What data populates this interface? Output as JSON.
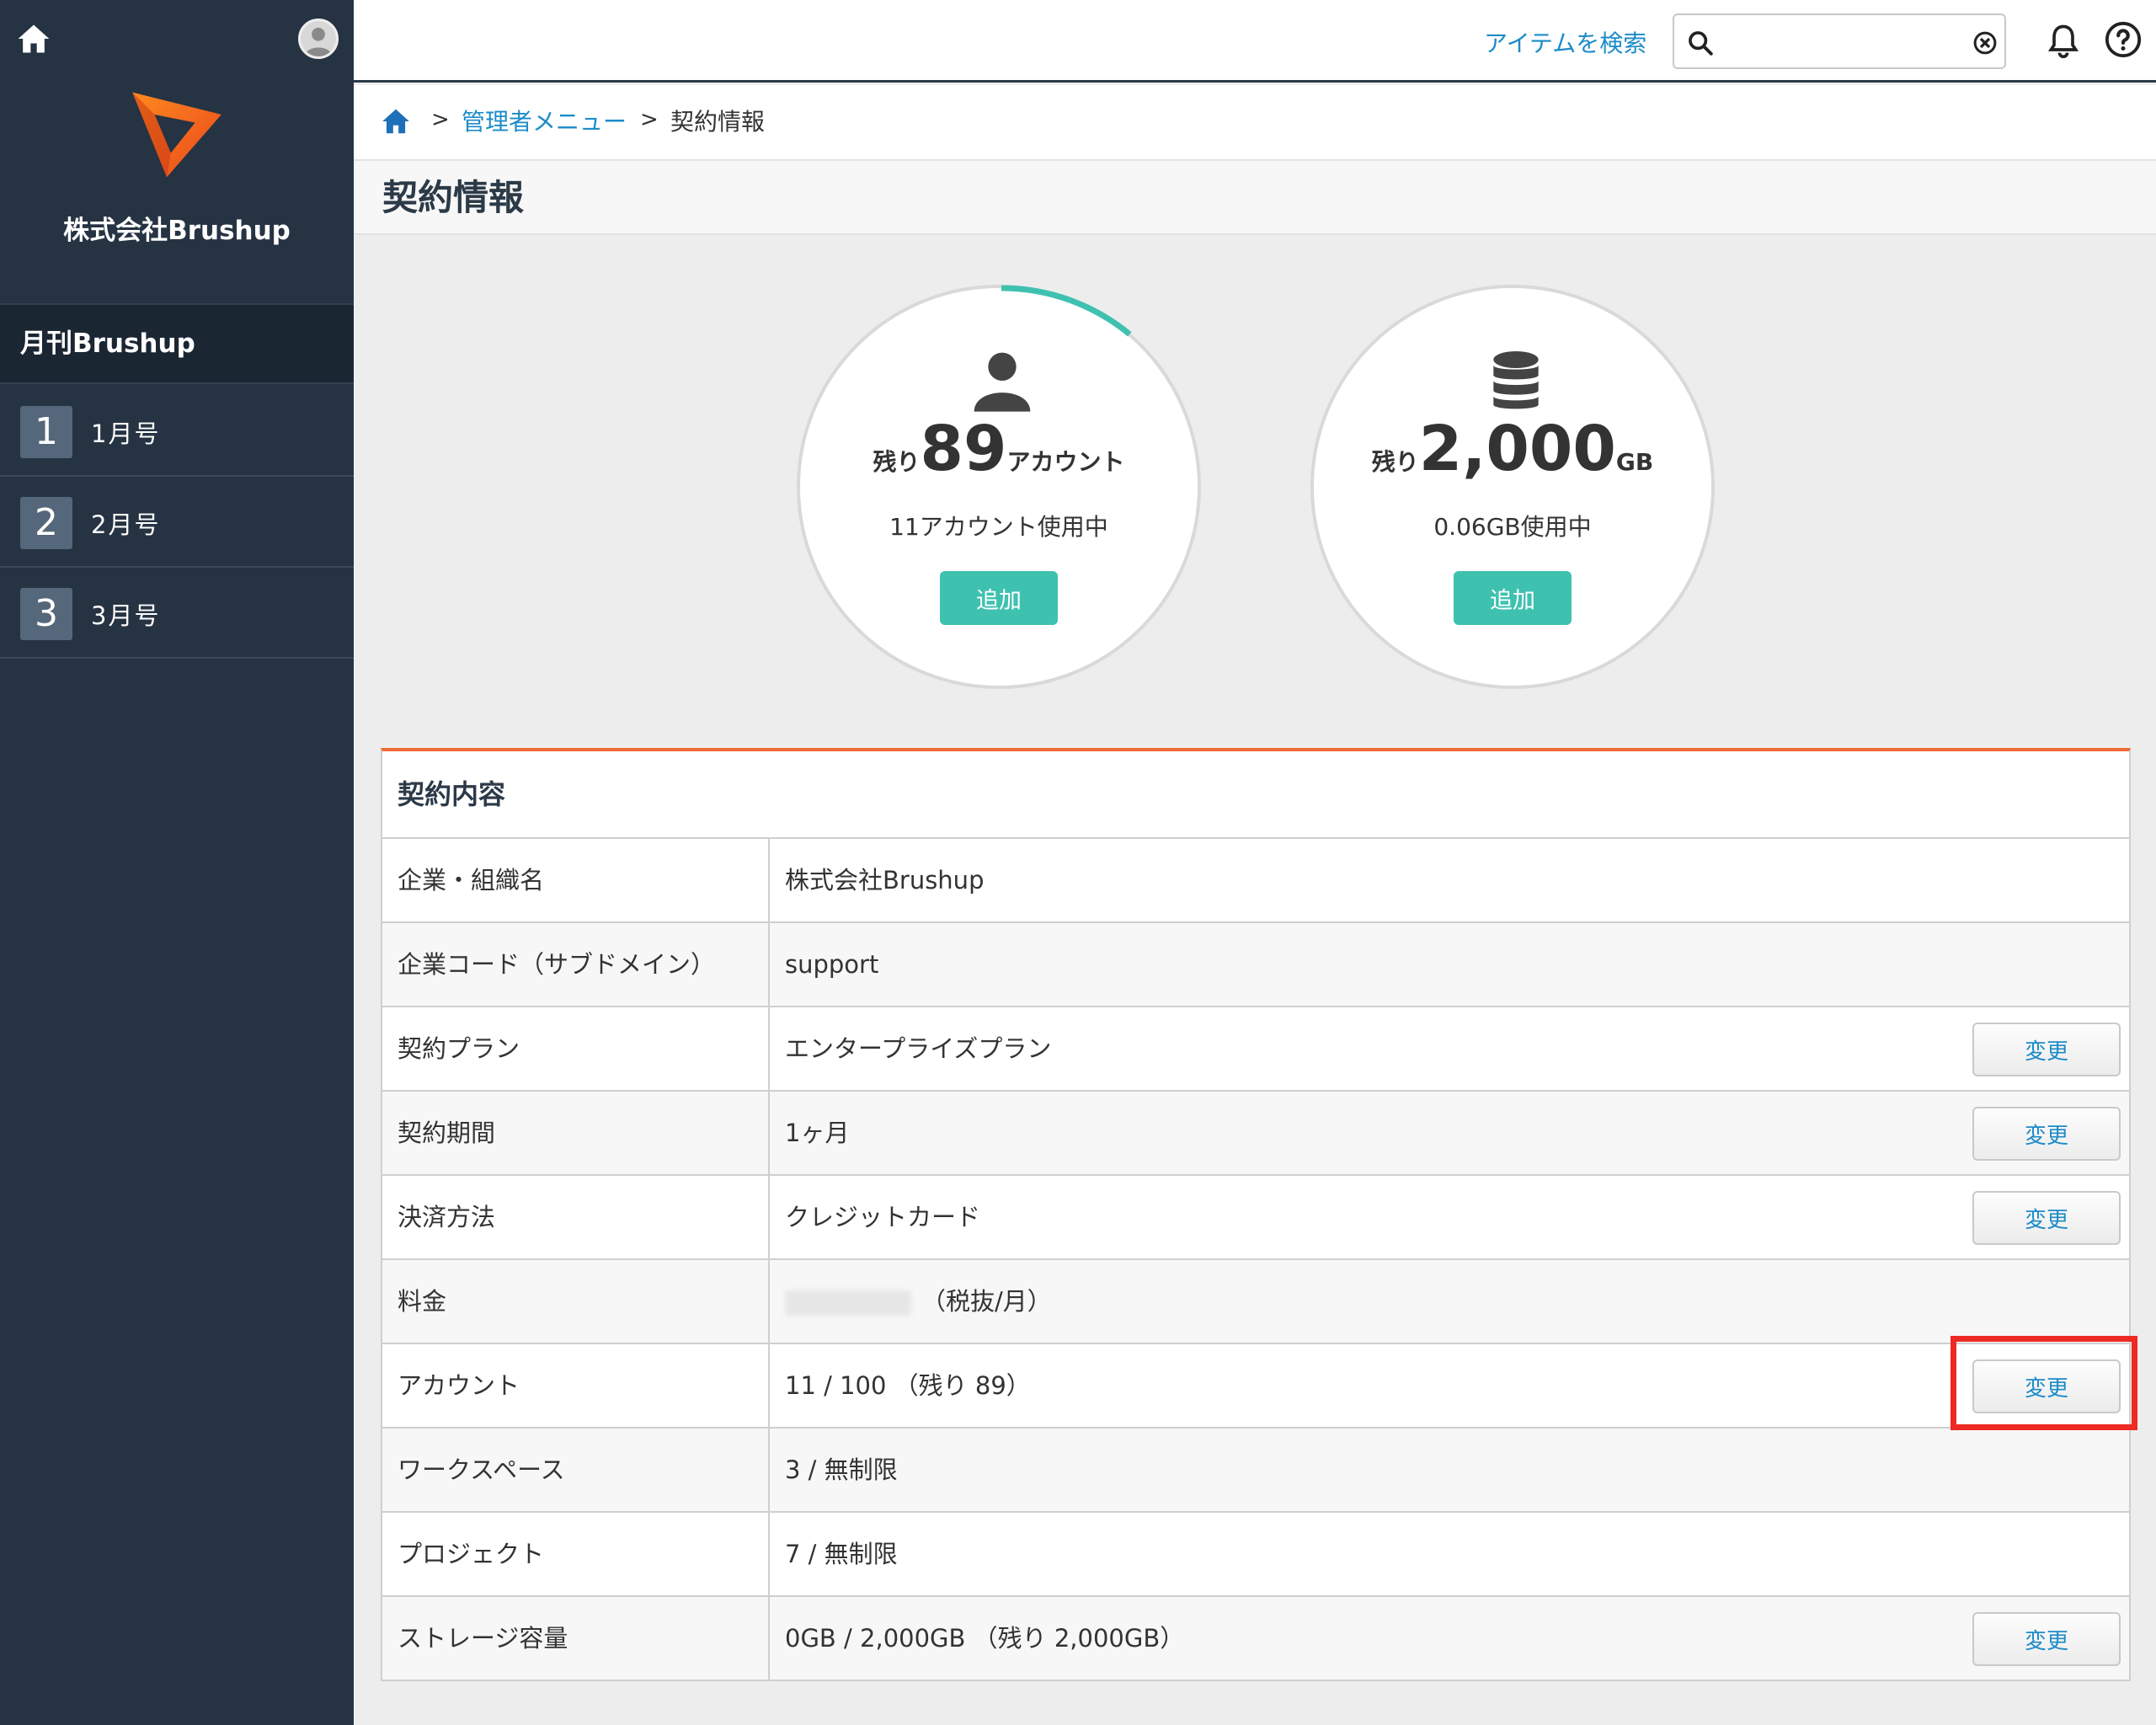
{
  "sidebar": {
    "company_name": "株式会社Brushup",
    "magazine_title": "月刊Brushup",
    "issues": [
      {
        "num": "1",
        "label": "1月号"
      },
      {
        "num": "2",
        "label": "2月号"
      },
      {
        "num": "3",
        "label": "3月号"
      }
    ]
  },
  "topbar": {
    "search_link": "アイテムを検索",
    "search_value": ""
  },
  "breadcrumb": {
    "sep": ">",
    "admin_menu": "管理者メニュー",
    "current": "契約情報"
  },
  "page_title": "契約情報",
  "summary": {
    "accounts": {
      "prefix": "残り",
      "value": "89",
      "unit": "アカウント",
      "usage": "11アカウント使用中",
      "add_label": "追加",
      "used_fraction": 0.11
    },
    "storage": {
      "prefix": "残り",
      "value": "2,000",
      "unit": "GB",
      "usage": "0.06GB使用中",
      "add_label": "追加"
    }
  },
  "contract": {
    "title": "契約内容",
    "change_label": "変更",
    "rows": [
      {
        "key": "企業・組織名",
        "value": "株式会社Brushup"
      },
      {
        "key": "企業コード（サブドメイン）",
        "value": "support"
      },
      {
        "key": "契約プラン",
        "value": "エンタープライズプラン"
      },
      {
        "key": "契約期間",
        "value": "1ヶ月"
      },
      {
        "key": "決済方法",
        "value": "クレジットカード"
      },
      {
        "key": "料金",
        "value": "（税抜/月）"
      },
      {
        "key": "アカウント",
        "value": "11 / 100 （残り 89）"
      },
      {
        "key": "ワークスペース",
        "value": "3 / 無制限"
      },
      {
        "key": "プロジェクト",
        "value": "7 / 無制限"
      },
      {
        "key": "ストレージ容量",
        "value": "0GB / 2,000GB （残り 2,000GB）"
      }
    ]
  },
  "colors": {
    "sidebar_bg": "#263343",
    "accent_teal": "#3fc1b0",
    "accent_orange": "#ef6c35",
    "link_blue": "#1d8bc8",
    "highlight_red": "#ee2a24"
  }
}
